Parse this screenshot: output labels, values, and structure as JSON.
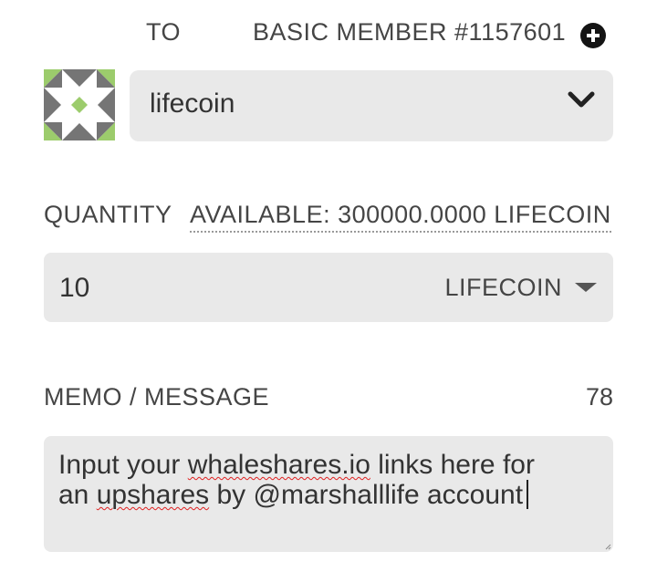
{
  "header": {
    "to_label": "TO",
    "member_label": "BASIC MEMBER #1157601",
    "add_icon": "plus-circle-icon"
  },
  "account": {
    "avatar_icon": "identicon",
    "selected_value": "lifecoin",
    "dropdown_icon": "chevron-down-icon"
  },
  "quantity": {
    "label": "QUANTITY",
    "available": "AVAILABLE: 300000.0000 LIFECOIN",
    "value": "10",
    "asset": "LIFECOIN",
    "asset_icon": "caret-down-icon"
  },
  "memo": {
    "label": "MEMO / MESSAGE",
    "remaining_count": "78",
    "text_before_1": "Input your ",
    "misspelled_1": "whaleshares.io",
    "text_after_1": " links here for",
    "text_before_2": "an ",
    "misspelled_2": "upshares",
    "text_after_2": " by @marshalllife account"
  },
  "colors": {
    "field_bg": "#e9e9e9",
    "label_text": "#454545",
    "identicon_green": "#9ccc6c",
    "identicon_gray": "#757575",
    "spellcheck_red": "#e02020"
  }
}
